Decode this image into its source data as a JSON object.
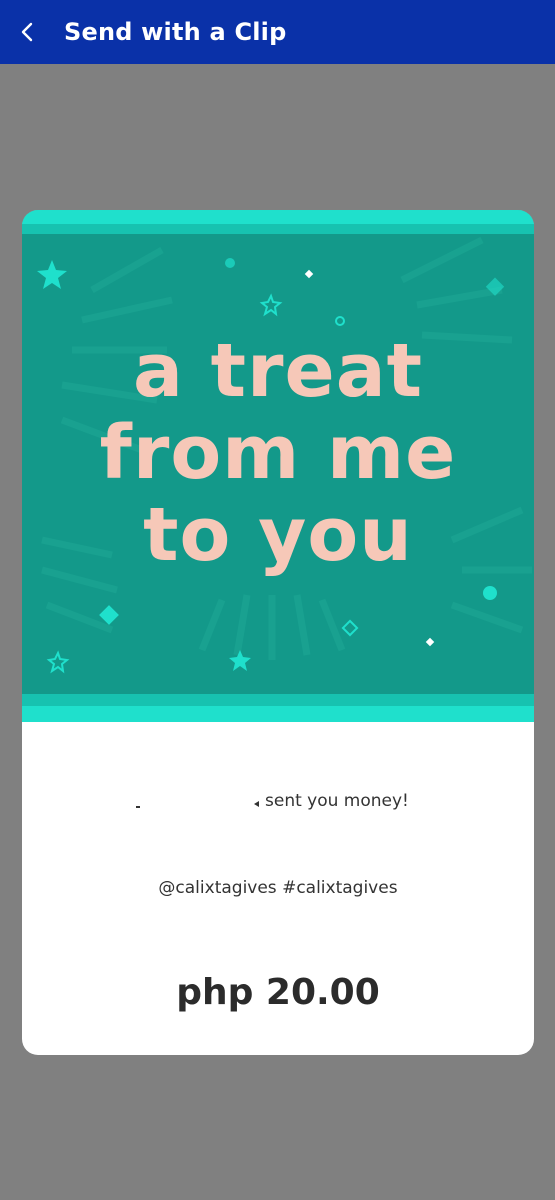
{
  "header": {
    "title": "Send with a Clip",
    "back_icon": "chevron-left-icon",
    "background_color": "#0a31a8"
  },
  "card": {
    "art": {
      "line1": "a treat",
      "line2": "from me",
      "line3": "to you",
      "background_color": "#13998a",
      "band_color": "#1fe0cc",
      "text_color": "#f6c8b8"
    },
    "message": "sent you money!",
    "tags": "@calixtagives #calixtagives",
    "amount": "php 20.00"
  }
}
